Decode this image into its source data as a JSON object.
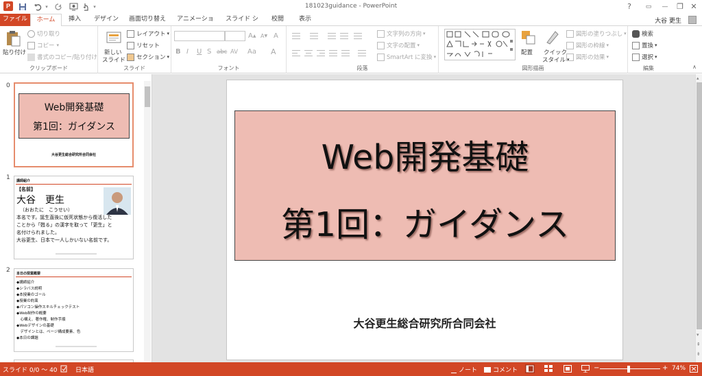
{
  "window": {
    "title": "181023guidance - PowerPoint",
    "controls": {
      "help": "?",
      "ribbon_options": "▭",
      "minimize": "—",
      "restore": "❐",
      "close": "✕"
    }
  },
  "quick_access": {
    "save_icon": "save-icon",
    "undo_icon": "undo-icon",
    "redo_icon": "redo-icon",
    "start_slideshow_icon": "slideshow-icon"
  },
  "tabs": [
    "ファイル",
    "ホーム",
    "挿入",
    "デザイン",
    "画面切り替え",
    "アニメーション",
    "スライド ショー",
    "校閲",
    "表示"
  ],
  "active_tab": "ホーム",
  "user": {
    "name": "大谷 更生"
  },
  "ribbon": {
    "clipboard": {
      "paste": "貼り付け",
      "cut": "切り取り",
      "copy": "コピー",
      "format_painter": "書式のコピー/貼り付け",
      "label": "クリップボード"
    },
    "slides": {
      "new_slide": "新しい",
      "new_slide2": "スライド",
      "layout": "レイアウト",
      "reset": "リセット",
      "section": "セクション",
      "label": "スライド"
    },
    "font": {
      "label": "フォント",
      "bold": "B",
      "italic": "I",
      "underline": "U",
      "shadow": "S",
      "strike": "abc",
      "spacing": "AV",
      "case": "Aa",
      "color": "A",
      "grow": "A",
      "shrink": "A",
      "clear": "A"
    },
    "paragraph": {
      "text_direction": "文字列の方向",
      "align_text": "文字の配置",
      "smartart": "SmartArt に変換",
      "label": "段落"
    },
    "drawing": {
      "arrange": "配置",
      "quick_styles": "クイック",
      "quick_styles2": "スタイル",
      "shape_fill": "図形の塗りつぶし",
      "shape_outline": "図形の枠線",
      "shape_effects": "図形の効果",
      "label": "図形描画"
    },
    "editing": {
      "find": "検索",
      "replace": "置換",
      "select": "選択",
      "label": "編集"
    }
  },
  "thumbnails": [
    {
      "number": "0",
      "title1": "Web開発基礎",
      "title2": "第1回：ガイダンス",
      "footer": "大谷更生総合研究所合同会社"
    },
    {
      "number": "1",
      "heading": "講師紹介",
      "name_label": "【名前】",
      "name": "大谷　更生",
      "reading": "（おおたに　こうせい）",
      "lines": [
        "本名です。誕生直後に仮死状態から復活した",
        "ことから「甦る」の漢字を取って「更生」と",
        "名付けられました。",
        "大谷更生、日本で一人しかいない名前です。"
      ]
    },
    {
      "number": "2",
      "heading": "本日の授業概要",
      "lines": [
        "◆講師紹介",
        "◆シラバス説明",
        "◆本授業のゴール",
        "◆授業の約束",
        "◆パソコン操作スキルチェックテスト",
        "◆Web制作の概要",
        "　心構え、著作権、制作手順",
        "◆Webデザインの基礎",
        "　デザインとは、ページ構成要素、色",
        "◆本日の課題"
      ]
    }
  ],
  "slide": {
    "title_line1": "Web開発基礎",
    "title_line2": "第1回：ガイダンス",
    "subtitle": "大谷更生総合研究所合同会社"
  },
  "statusbar": {
    "slide_indicator": "スライド 0/0 〜 40",
    "language": "日本語",
    "notes": "ノート",
    "comments": "コメント",
    "zoom": "74%",
    "zoom_level": 0.74
  },
  "colors": {
    "accent": "#d24726",
    "slide_title_box": "#eebcb3",
    "selected_thumb_border": "#e68c6c"
  }
}
